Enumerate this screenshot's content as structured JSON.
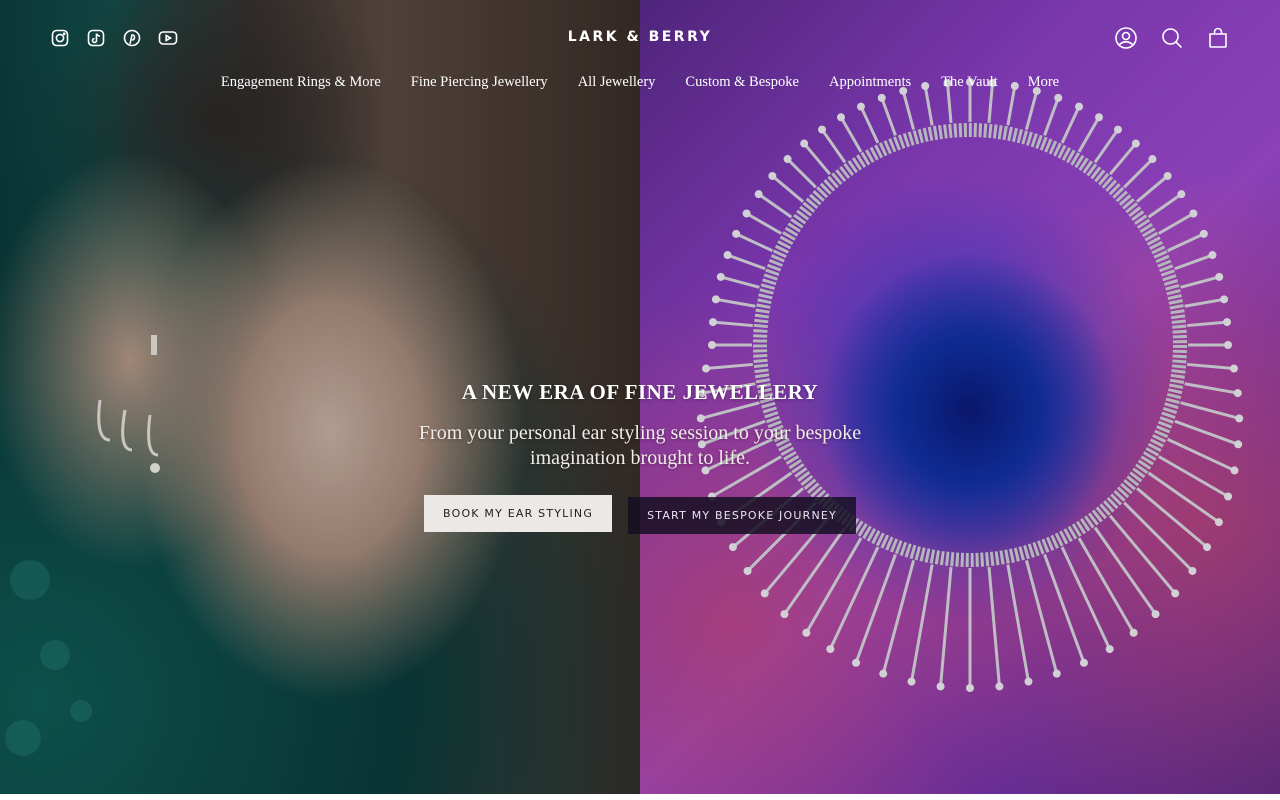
{
  "header": {
    "logo": "LARK & BERRY",
    "social": [
      {
        "icon": "instagram-icon"
      },
      {
        "icon": "tiktok-icon"
      },
      {
        "icon": "pinterest-icon"
      },
      {
        "icon": "youtube-icon"
      }
    ],
    "utilities": [
      {
        "icon": "account-icon"
      },
      {
        "icon": "search-icon"
      },
      {
        "icon": "cart-icon"
      }
    ]
  },
  "nav": {
    "items": [
      {
        "label": "Engagement Rings & More"
      },
      {
        "label": "Fine Piercing Jewellery"
      },
      {
        "label": "All Jewellery"
      },
      {
        "label": "Custom & Bespoke"
      },
      {
        "label": "Appointments"
      },
      {
        "label": "The Vault"
      },
      {
        "label": "More"
      }
    ]
  },
  "hero": {
    "headline": "A NEW ERA OF FINE JEWELLERY",
    "subtext": "From your personal ear styling session to your bespoke imagination brought to life.",
    "primary_button": "BOOK MY EAR STYLING",
    "secondary_button": "START MY BESPOKE JOURNEY",
    "left_image": "woman-with-ear-jewellery",
    "right_image": "diamond-necklace-on-purple-powder"
  },
  "colors": {
    "text": "#ffffff",
    "primary_button_bg": "#ebe8e6",
    "secondary_button_bg": "#140f23",
    "left_bg": "#0b3f3d",
    "right_bg": "#8a3fc4"
  }
}
